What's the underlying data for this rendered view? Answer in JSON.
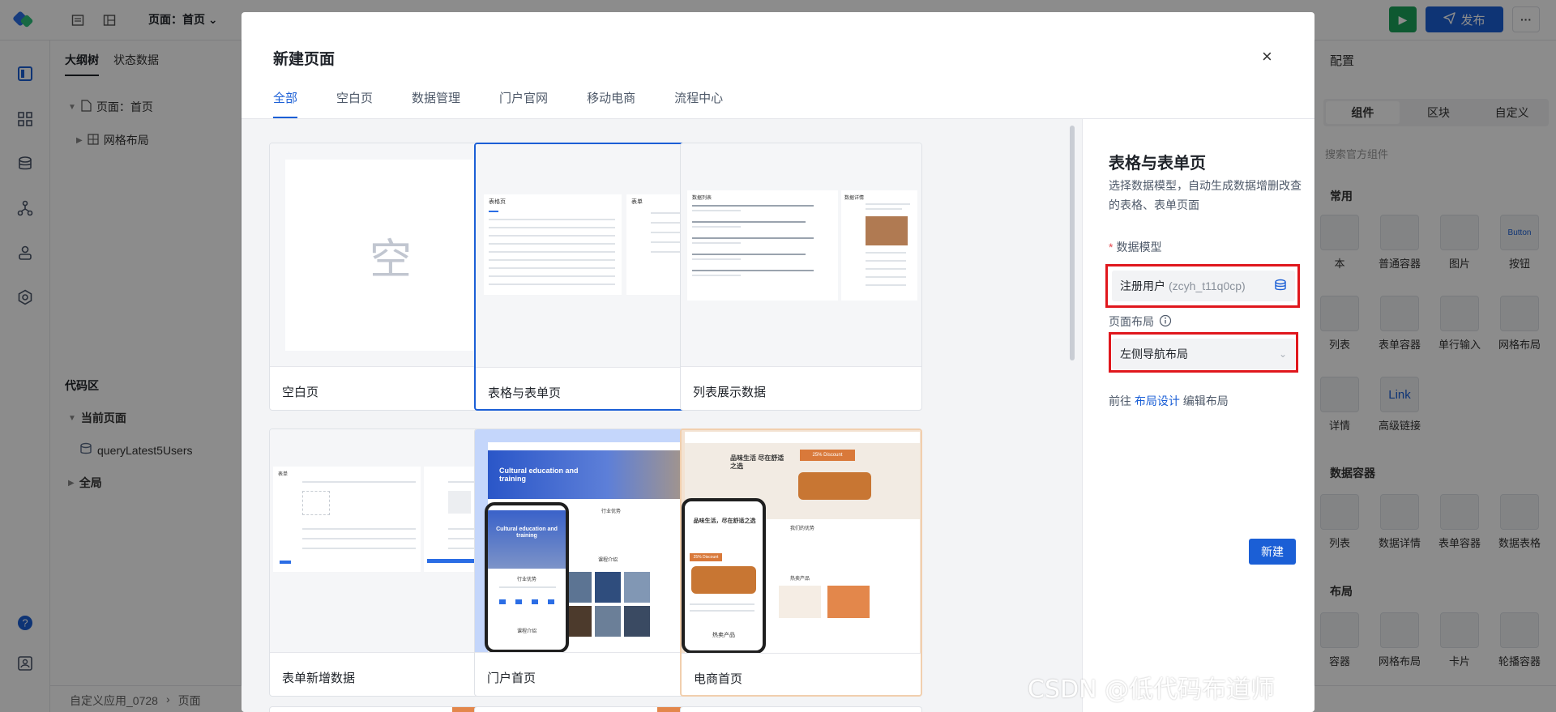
{
  "app": {
    "page_select": "页面：首页",
    "publish_label": "发布",
    "more_label": "···"
  },
  "outline": {
    "tab_outline": "大纲树",
    "tab_state": "状态数据",
    "tree_page": "页面：首页",
    "tree_grid": "网格布局",
    "code_title": "代码区",
    "current_page": "当前页面",
    "query": "queryLatest5Users",
    "global": "全局"
  },
  "bottombar": {
    "breadcrumb_app": "自定义应用_0728",
    "breadcrumb_page": "页面"
  },
  "rightpanel": {
    "title": "配置",
    "tabs": [
      "组件",
      "区块",
      "自定义"
    ],
    "search_placeholder": "搜索官方组件",
    "sections": {
      "common": "常用",
      "data_container": "数据容器",
      "layout": "布局"
    },
    "row1": [
      "本",
      "普通容器",
      "图片",
      "按钮"
    ],
    "row2": [
      "列表",
      "表单容器",
      "单行输入",
      "网格布局"
    ],
    "row3": [
      "详情",
      "高级链接"
    ],
    "row4": [
      "列表",
      "数据详情",
      "表单容器",
      "数据表格"
    ],
    "row5": [
      "容器",
      "网格布局",
      "卡片",
      "轮播容器"
    ],
    "thumb_button": "Button",
    "thumb_link": "Link"
  },
  "modal": {
    "title": "新建页面",
    "close": "×",
    "tabs": [
      "全部",
      "空白页",
      "数据管理",
      "门户官网",
      "移动电商",
      "流程中心"
    ],
    "cards": [
      {
        "label": "空白页",
        "empty_char": "空"
      },
      {
        "label": "表格与表单页"
      },
      {
        "label": "列表展示数据"
      },
      {
        "label": "表单新增数据"
      },
      {
        "label": "门户首页",
        "hero": "Cultural education and training"
      },
      {
        "label": "电商首页",
        "hero": "品味生活 尽在舒适之选",
        "badge": "25% Discount",
        "badge2": "25% Discount"
      }
    ],
    "mini_texts": {
      "table_title": "表格页",
      "form_title": "表单",
      "list_title": "数据列表",
      "detail_title": "数据详情",
      "formadd_title": "表单",
      "portal_sub1": "行业优势",
      "portal_sub2": "课程介绍",
      "ecom_sub1": "我们的优势",
      "ecom_sub2": "热卖产品",
      "ecom_mobile_hero": "品味生活，尽在舒适之选",
      "ecom_mobile_sub": "热卖产品"
    },
    "config": {
      "title": "表格与表单页",
      "desc": "选择数据模型，自动生成数据增删改查的表格、表单页面",
      "model_label": "数据模型",
      "model_value": "注册用户",
      "model_code": "(zcyh_t11q0cp)",
      "layout_label": "页面布局",
      "layout_value": "左侧导航布局",
      "link_prefix": "前往",
      "link_text": "布局设计",
      "link_suffix": "编辑布局",
      "create_label": "新建"
    }
  },
  "watermark": "CSDN @低代码布道师",
  "colors": {
    "primary": "#1b5fd6",
    "highlight": "#e0171d",
    "green": "#1aa35a"
  }
}
